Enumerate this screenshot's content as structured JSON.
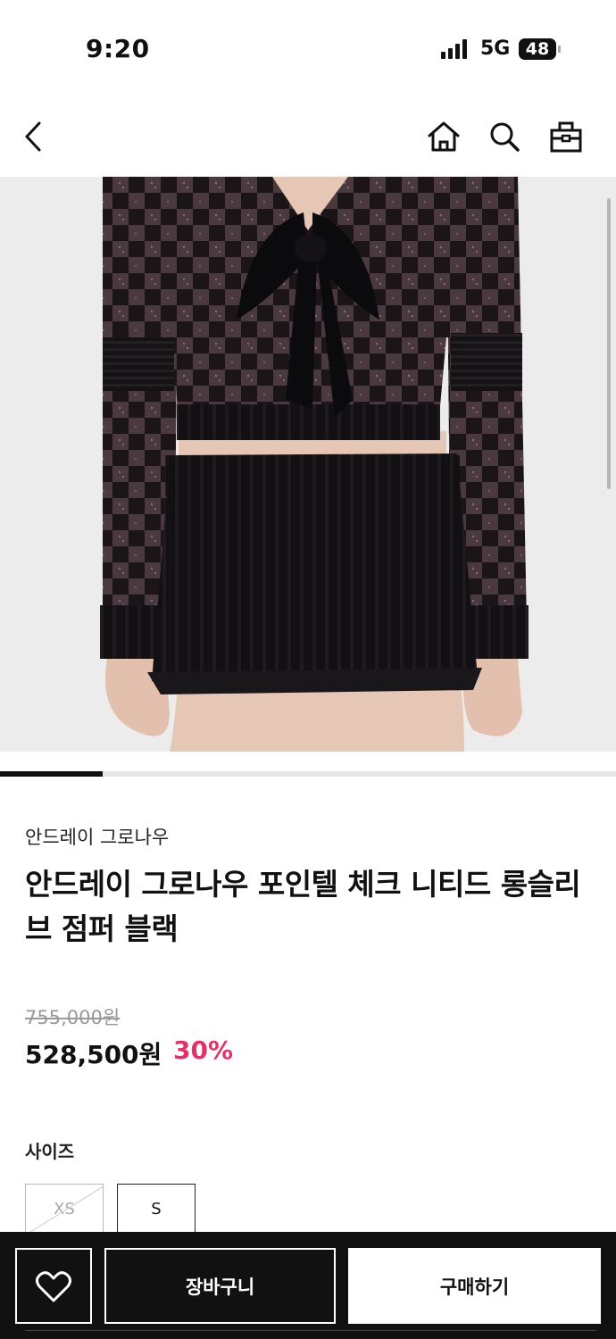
{
  "status": {
    "time": "9:20",
    "network": "5G",
    "battery": "48"
  },
  "nav": {
    "back_icon": "chevron-left-icon",
    "home_icon": "home-icon",
    "search_icon": "search-icon",
    "cart_icon": "shopping-bag-icon"
  },
  "gallery": {
    "current_image": 1,
    "total_images": 6
  },
  "product": {
    "brand": "안드레이 그로나우",
    "title": "안드레이 그로나우 포인텔 체크 니티드 롱슬리브 점퍼 블랙",
    "original_price": "755,000원",
    "sale_price": "528,500원",
    "discount": "30%"
  },
  "size": {
    "label": "사이즈",
    "options": [
      {
        "label": "XS",
        "available": false
      },
      {
        "label": "S",
        "available": true
      }
    ]
  },
  "actions": {
    "wishlist_icon": "heart-icon",
    "add_to_cart": "장바구니",
    "buy_now": "구매하기"
  },
  "colors": {
    "accent_discount": "#e0336b",
    "bar": "#111111"
  }
}
